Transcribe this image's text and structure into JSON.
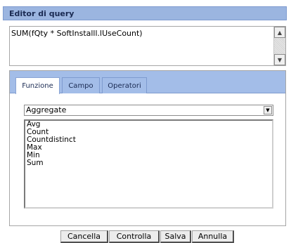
{
  "window": {
    "title": "Editor di query"
  },
  "editor": {
    "value": "SUM(fQty * SoftInstalll.lUseCount)"
  },
  "tabs": [
    {
      "label": "Funzione",
      "active": true
    },
    {
      "label": "Campo",
      "active": false
    },
    {
      "label": "Operatori",
      "active": false
    }
  ],
  "function_select": {
    "selected": "Aggregate"
  },
  "function_list": [
    "Avg",
    "Count",
    "Countdistinct",
    "Max",
    "Min",
    "Sum"
  ],
  "buttons": {
    "cancel": "Cancella",
    "check": "Controlla",
    "save": "Salva",
    "abort": "Annulla"
  },
  "icons": {
    "scroll_up": "chevron-up-icon",
    "scroll_down": "chevron-down-icon",
    "select_arrow": "chevron-down-icon"
  },
  "colors": {
    "header_bg": "#9bb5e0",
    "tabbar_bg": "#a3bde8",
    "header_text": "#1a2a52"
  }
}
